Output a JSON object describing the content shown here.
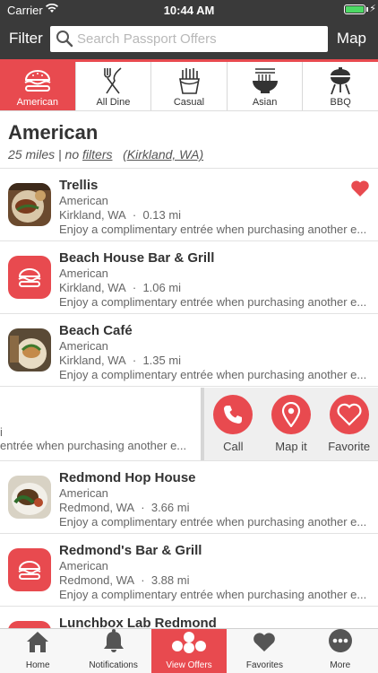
{
  "status_bar": {
    "carrier": "Carrier",
    "time": "10:44 AM"
  },
  "header": {
    "filter_label": "Filter",
    "search_placeholder": "Search Passport Offers",
    "map_label": "Map"
  },
  "categories": [
    {
      "label": "American",
      "icon": "burger-icon",
      "active": true
    },
    {
      "label": "All Dine",
      "icon": "fork-knife-icon"
    },
    {
      "label": "Casual",
      "icon": "fries-icon"
    },
    {
      "label": "Asian",
      "icon": "noodle-bowl-icon"
    },
    {
      "label": "BBQ",
      "icon": "grill-icon"
    }
  ],
  "section": {
    "title": "American",
    "distance": "25 miles",
    "separator": " | no ",
    "filters_link": "filters",
    "location_link": "(Kirkland, WA)"
  },
  "offer_text": "Enjoy a complimentary entrée when purchasing another e...",
  "restaurants": [
    {
      "name": "Trellis",
      "cuisine": "American",
      "location": "Kirkland, WA",
      "distance": "0.13 mi",
      "favorited": true
    },
    {
      "name": "Beach House Bar & Grill",
      "cuisine": "American",
      "location": "Kirkland, WA",
      "distance": "1.06 mi"
    },
    {
      "name": "Beach Café",
      "cuisine": "American",
      "location": "Kirkland, WA",
      "distance": "1.35 mi"
    },
    {
      "name": "",
      "partial_line1": "i",
      "partial_line2": "entrée when purchasing another e..."
    },
    {
      "name": "Redmond Hop House",
      "cuisine": "American",
      "location": "Redmond, WA",
      "distance": "3.66 mi"
    },
    {
      "name": "Redmond's Bar & Grill",
      "cuisine": "American",
      "location": "Redmond, WA",
      "distance": "3.88 mi"
    },
    {
      "name": "Lunchbox Lab Redmond"
    }
  ],
  "swipe_actions": [
    {
      "label": "Call",
      "icon": "phone-icon"
    },
    {
      "label": "Map it",
      "icon": "map-pin-icon"
    },
    {
      "label": "Favorite",
      "icon": "heart-outline-icon"
    }
  ],
  "tabs": [
    {
      "label": "Home",
      "icon": "home-icon"
    },
    {
      "label": "Notifications",
      "icon": "bell-icon"
    },
    {
      "label": "View Offers",
      "icon": "dots-icon",
      "active": true
    },
    {
      "label": "Favorites",
      "icon": "heart-icon"
    },
    {
      "label": "More",
      "icon": "more-icon"
    }
  ],
  "colors": {
    "accent": "#e84a4f",
    "header_bg": "#3a3a3a",
    "battery": "#4cd964"
  }
}
